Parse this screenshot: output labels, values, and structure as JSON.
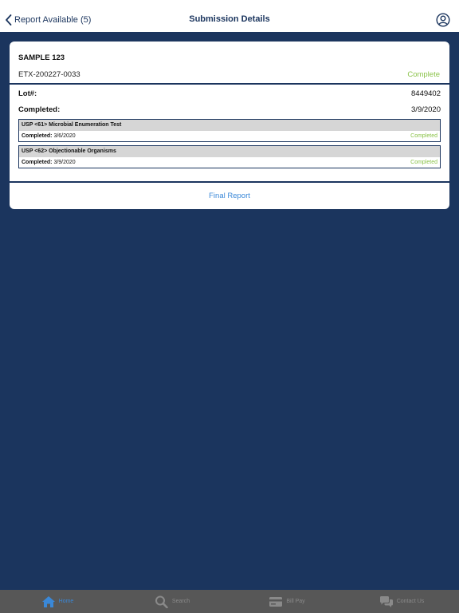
{
  "nav": {
    "back_label": "Report Available (5)",
    "title": "Submission Details",
    "profile_icon": "profile-icon"
  },
  "submission": {
    "sample_name": "SAMPLE 123",
    "id": "ETX-200227-0033",
    "status": "Complete",
    "lot_label": "Lot#:",
    "lot_value": "8449402",
    "completed_label": "Completed:",
    "completed_value": "3/9/2020",
    "tests": [
      {
        "name": "USP <61> Microbial Enumeration Test",
        "completed_label": "Completed:",
        "completed_date": "3/6/2020",
        "status": "Completed"
      },
      {
        "name": "USP <62> Objectionable Organisms",
        "completed_label": "Completed:",
        "completed_date": "3/9/2020",
        "status": "Completed"
      }
    ],
    "final_report_label": "Final Report"
  },
  "tabbar": {
    "items": [
      {
        "label": "Home",
        "icon": "home-icon",
        "active": true
      },
      {
        "label": "Search",
        "icon": "search-icon",
        "active": false
      },
      {
        "label": "Bill Pay",
        "icon": "credit-card-icon",
        "active": false
      },
      {
        "label": "Contact Us",
        "icon": "chat-bubbles-icon",
        "active": false
      }
    ]
  },
  "colors": {
    "navy": "#1b355e",
    "complete_green": "#8bc34a",
    "link_blue": "#3a88d8",
    "tabbar_bg": "#575757"
  }
}
